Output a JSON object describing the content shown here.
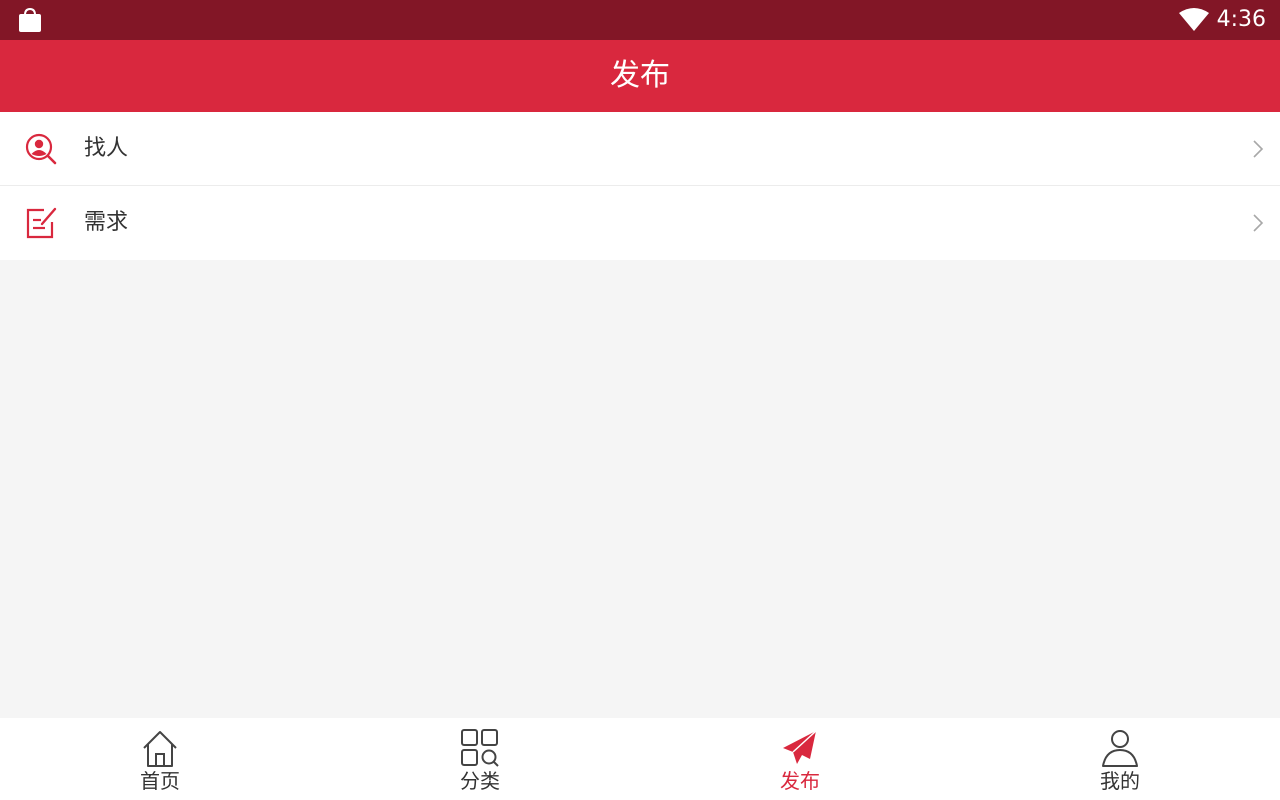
{
  "status_bar": {
    "time": "4:36",
    "icons": [
      "shopping-bag-icon",
      "wifi-icon"
    ]
  },
  "header": {
    "title": "发布"
  },
  "menu": {
    "items": [
      {
        "label": "找人",
        "icon": "find-person-icon"
      },
      {
        "label": "需求",
        "icon": "edit-note-icon"
      }
    ]
  },
  "tab_bar": {
    "active_index": 2,
    "tabs": [
      {
        "label": "首页",
        "icon": "home-icon"
      },
      {
        "label": "分类",
        "icon": "category-grid-icon"
      },
      {
        "label": "发布",
        "icon": "paper-plane-icon"
      },
      {
        "label": "我的",
        "icon": "user-icon"
      }
    ]
  },
  "colors": {
    "status_bar": "#821626",
    "accent": "#d9283e",
    "background": "#f5f5f5",
    "text": "#333333"
  }
}
